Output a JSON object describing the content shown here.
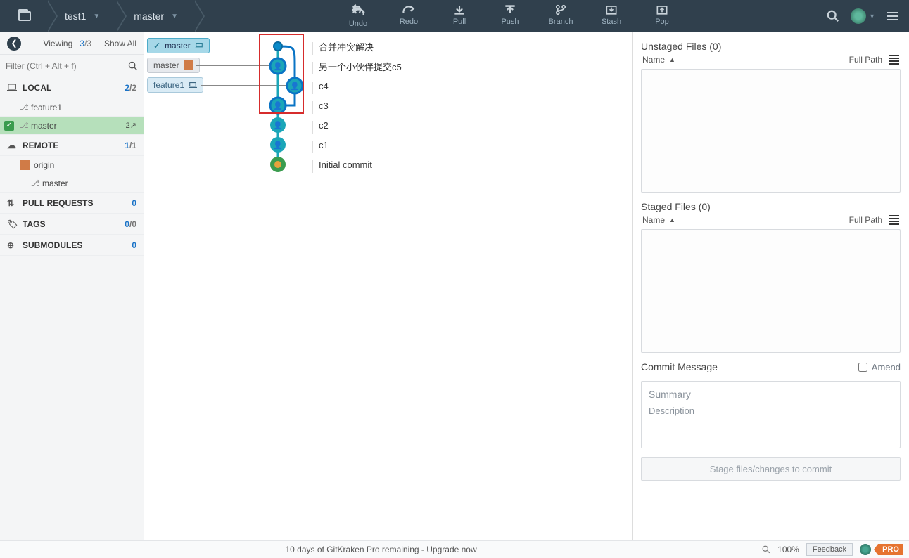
{
  "header": {
    "repo": "test1",
    "branch": "master",
    "tools": {
      "undo": "Undo",
      "redo": "Redo",
      "pull": "Pull",
      "push": "Push",
      "branch": "Branch",
      "stash": "Stash",
      "pop": "Pop"
    }
  },
  "sidebar": {
    "viewing_label": "Viewing",
    "viewing_current": "3",
    "viewing_total": "/3",
    "show_all": "Show All",
    "filter_placeholder": "Filter (Ctrl + Alt + f)",
    "sections": {
      "local": {
        "label": "LOCAL",
        "count_active": "2",
        "count_total": "/2",
        "branches": [
          {
            "name": "feature1",
            "meta": ""
          },
          {
            "name": "master",
            "meta": "2↗",
            "active": true
          }
        ]
      },
      "remote": {
        "label": "REMOTE",
        "count_active": "1",
        "count_total": "/1",
        "remotes": [
          {
            "name": "origin",
            "children": [
              {
                "name": "master"
              }
            ]
          }
        ]
      },
      "pull_requests": {
        "label": "PULL REQUESTS",
        "count": "0"
      },
      "tags": {
        "label": "TAGS",
        "count_active": "0",
        "count_total": "/0"
      },
      "submodules": {
        "label": "SUBMODULES",
        "count": "0"
      }
    }
  },
  "graph": {
    "refs": {
      "master_local": "master",
      "master_remote": "master",
      "feature1": "feature1"
    },
    "commits": [
      {
        "msg": "合并冲突解决"
      },
      {
        "msg": "另一个小伙伴提交c5"
      },
      {
        "msg": "c4"
      },
      {
        "msg": "c3"
      },
      {
        "msg": "c2"
      },
      {
        "msg": "c1"
      },
      {
        "msg": "Initial commit"
      }
    ]
  },
  "right": {
    "unstaged_title": "Unstaged Files (0)",
    "staged_title": "Staged Files (0)",
    "name_col": "Name",
    "fullpath_col": "Full Path",
    "commit_msg_label": "Commit Message",
    "amend_label": "Amend",
    "summary_placeholder": "Summary",
    "description_placeholder": "Description",
    "stage_btn": "Stage files/changes to commit"
  },
  "statusbar": {
    "center": "10 days of GitKraken Pro remaining - Upgrade now",
    "zoom": "100%",
    "feedback": "Feedback",
    "pro": "PRO"
  }
}
